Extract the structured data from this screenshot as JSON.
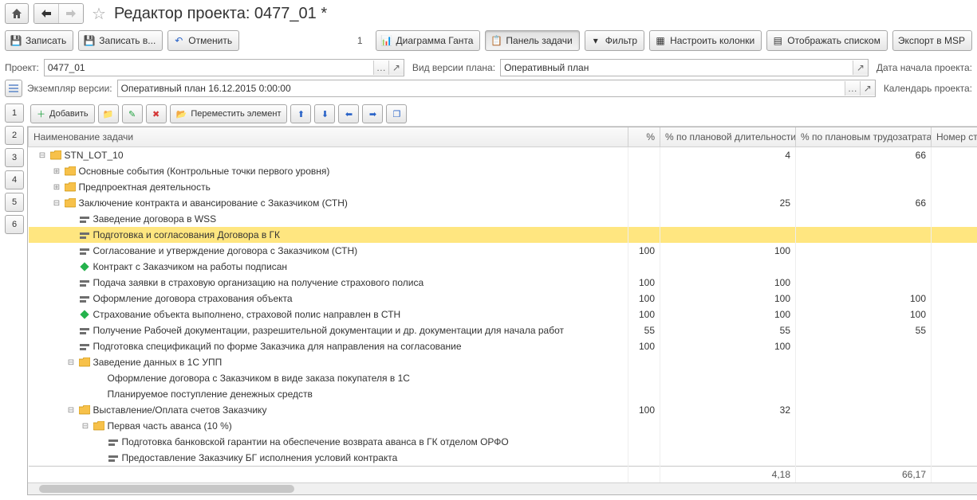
{
  "title": "Редактор проекта: 0477_01 *",
  "toolbar": {
    "save": "Записать",
    "save_as": "Записать в...",
    "cancel": "Отменить",
    "number": "1",
    "gantt": "Диаграмма Ганта",
    "task_panel": "Панель задачи",
    "filter": "Фильтр",
    "columns": "Настроить колонки",
    "display_list": "Отображать списком",
    "export": "Экспорт в MSP"
  },
  "params": {
    "project_label": "Проект:",
    "project_value": "0477_01",
    "plan_version_label": "Вид версии плана:",
    "plan_version_value": "Оперативный план",
    "start_date_label": "Дата начала проекта:",
    "version_inst_label": "Экземпляр версии:",
    "version_inst_value": "Оперативный план 16.12.2015 0:00:00",
    "calendar_label": "Календарь проекта:"
  },
  "side_tabs": [
    "1",
    "2",
    "3",
    "4",
    "5",
    "6"
  ],
  "tree_toolbar": {
    "add": "Добавить",
    "move": "Переместить элемент"
  },
  "columns": {
    "name": "Наименование задачи",
    "pct": "%",
    "pct_dur": "% по плановой длительности",
    "pct_labor": "% по плановым трудозатратам",
    "row_no": "Номер ст"
  },
  "rows": [
    {
      "level": 0,
      "exp": "minus",
      "kind": "folder",
      "text": "STN_LOT_10",
      "pct": "",
      "dur": "4",
      "lab": "66"
    },
    {
      "level": 1,
      "exp": "plus",
      "kind": "folder",
      "text": "Основные события (Контрольные точки первого уровня)",
      "pct": "",
      "dur": "",
      "lab": ""
    },
    {
      "level": 1,
      "exp": "plus",
      "kind": "folder",
      "text": "Предпроектная деятельность",
      "pct": "",
      "dur": "",
      "lab": ""
    },
    {
      "level": 1,
      "exp": "minus",
      "kind": "folder",
      "text": "Заключение контракта и авансирование с Заказчиком (СТН)",
      "pct": "",
      "dur": "25",
      "lab": "66"
    },
    {
      "level": 2,
      "exp": "none",
      "kind": "task",
      "text": "Заведение договора в WSS",
      "pct": "",
      "dur": "",
      "lab": ""
    },
    {
      "level": 2,
      "exp": "none",
      "kind": "task",
      "text": "Подготовка и согласования Договора в ГК",
      "pct": "",
      "dur": "",
      "lab": "",
      "selected": true
    },
    {
      "level": 2,
      "exp": "none",
      "kind": "task",
      "text": "Согласование и утверждение договора с Заказчиком (СТН)",
      "pct": "100",
      "dur": "100",
      "lab": ""
    },
    {
      "level": 2,
      "exp": "none",
      "kind": "milestone",
      "text": "Контракт с Заказчиком на работы подписан",
      "pct": "",
      "dur": "",
      "lab": ""
    },
    {
      "level": 2,
      "exp": "none",
      "kind": "task",
      "text": "Подача заявки в страховую организацию на получение страхового полиса",
      "pct": "100",
      "dur": "100",
      "lab": ""
    },
    {
      "level": 2,
      "exp": "none",
      "kind": "task",
      "text": "Оформление договора страхования объекта",
      "pct": "100",
      "dur": "100",
      "lab": "100"
    },
    {
      "level": 2,
      "exp": "none",
      "kind": "milestone",
      "text": "Страхование объекта выполнено, страховой полис направлен в СТН",
      "pct": "100",
      "dur": "100",
      "lab": "100"
    },
    {
      "level": 2,
      "exp": "none",
      "kind": "task",
      "text": "Получение Рабочей документации, разрешительной документации и др. документации для начала работ",
      "pct": "55",
      "dur": "55",
      "lab": "55"
    },
    {
      "level": 2,
      "exp": "none",
      "kind": "task",
      "text": "Подготовка спецификаций по форме Заказчика для направления на согласование",
      "pct": "100",
      "dur": "100",
      "lab": ""
    },
    {
      "level": 2,
      "exp": "minus",
      "kind": "folder",
      "text": "Заведение данных в 1С УПП",
      "pct": "",
      "dur": "",
      "lab": ""
    },
    {
      "level": 3,
      "exp": "none",
      "kind": "task-noicon",
      "text": "Оформление договора с Заказчиком в виде заказа покупателя в 1С",
      "pct": "",
      "dur": "",
      "lab": ""
    },
    {
      "level": 3,
      "exp": "none",
      "kind": "task-noicon",
      "text": "Планируемое поступление денежных средств",
      "pct": "",
      "dur": "",
      "lab": ""
    },
    {
      "level": 2,
      "exp": "minus",
      "kind": "folder",
      "text": "Выставление/Оплата счетов Заказчику",
      "pct": "100",
      "dur": "32",
      "lab": ""
    },
    {
      "level": 3,
      "exp": "minus",
      "kind": "folder",
      "text": "Первая часть аванса  (10 %)",
      "pct": "",
      "dur": "",
      "lab": ""
    },
    {
      "level": 4,
      "exp": "none",
      "kind": "task",
      "text": "Подготовка банковской гарантии на обеспечение возврата аванса в ГК отделом ОРФО",
      "pct": "",
      "dur": "",
      "lab": ""
    },
    {
      "level": 4,
      "exp": "none",
      "kind": "task",
      "text": "Предоставление Заказчику БГ исполнения условий контракта",
      "pct": "",
      "dur": "",
      "lab": ""
    }
  ],
  "footer": {
    "dur": "4,18",
    "lab": "66,17"
  }
}
